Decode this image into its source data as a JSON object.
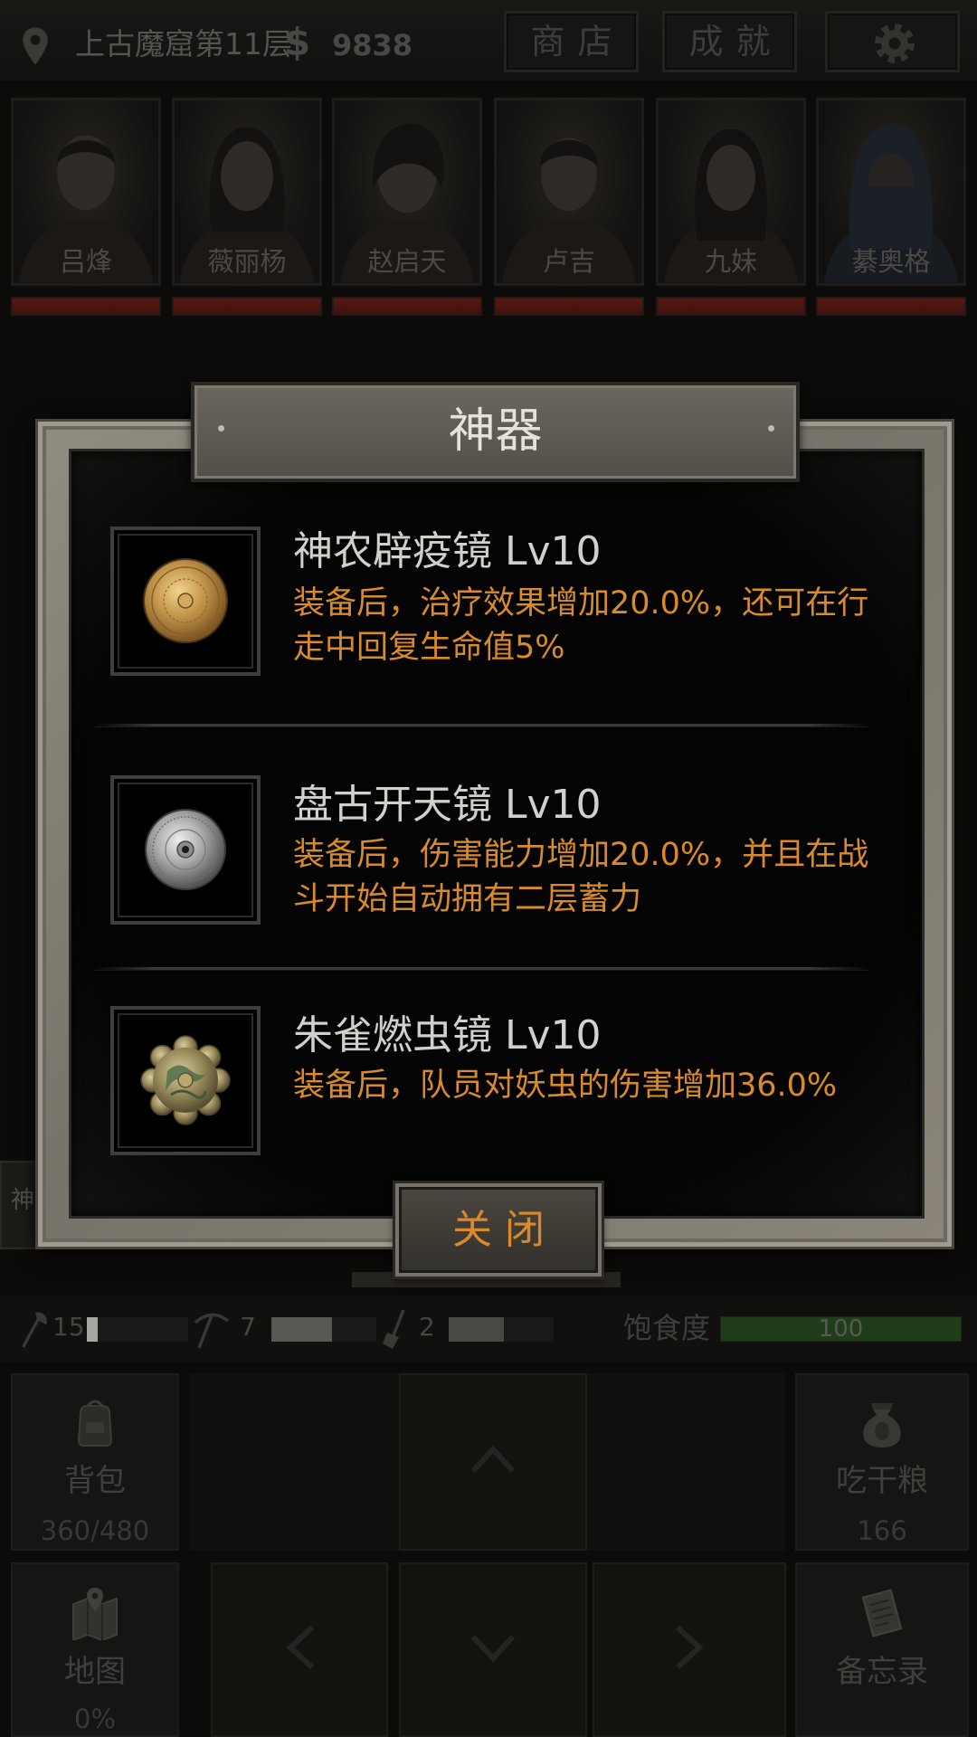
{
  "top_bar": {
    "location": "上古魔窟第11层",
    "currency_symbol": "$",
    "money": "9838",
    "shop_label": "商店",
    "achievements_label": "成就",
    "location_icon": "map-pin-icon",
    "settings_icon": "gear-icon"
  },
  "party": [
    {
      "name": "吕烽",
      "hp": 1.0
    },
    {
      "name": "薇丽杨",
      "hp": 1.0
    },
    {
      "name": "赵启天",
      "hp": 1.0
    },
    {
      "name": "卢吉",
      "hp": 1.0
    },
    {
      "name": "九妹",
      "hp": 1.0
    },
    {
      "name": "綦奥格",
      "hp": 1.0
    }
  ],
  "background_tab": {
    "label": "神"
  },
  "modal": {
    "title": "神器",
    "items": [
      {
        "name": "神农辟疫镜",
        "level": "Lv10",
        "description": [
          "装备后，治疗效果增加20.0%，还可在行",
          "走中回复生命值5%"
        ],
        "icon": "gold-bronze-mirror-icon"
      },
      {
        "name": "盘古开天镜",
        "level": "Lv10",
        "description": [
          "装备后，伤害能力增加20.0%，并且在战",
          "斗开始自动拥有二层蓄力"
        ],
        "icon": "silver-mirror-icon"
      },
      {
        "name": "朱雀燃虫镜",
        "level": "Lv10",
        "description": [
          "装备后，队员对妖虫的伤害增加36.0%"
        ],
        "icon": "jade-flower-mirror-icon"
      }
    ],
    "close_label": "关 闭"
  },
  "status_bar": {
    "tools": [
      {
        "icon": "axe-icon",
        "count": "15",
        "fill": 0.11
      },
      {
        "icon": "pickaxe-icon",
        "count": "7",
        "fill": 0.58
      },
      {
        "icon": "shovel-icon",
        "count": "2",
        "fill": 0.53
      }
    ],
    "satiety_label": "饱食度",
    "satiety_value": "100",
    "satiety_fill": 1.0
  },
  "actions": {
    "backpack": {
      "label": "背包",
      "value": "360/480",
      "icon": "backpack-icon"
    },
    "eat": {
      "label": "吃干粮",
      "value": "166",
      "icon": "ration-sack-icon"
    },
    "map": {
      "label": "地图",
      "value": "0%",
      "icon": "map-icon"
    },
    "memo": {
      "label": "备忘录",
      "icon": "memo-icon"
    },
    "arrows": [
      "up-arrow-icon",
      "left-arrow-icon",
      "down-arrow-icon",
      "right-arrow-icon"
    ]
  },
  "colors": {
    "accent_orange": "#d98a2b",
    "hp_red": "#571914",
    "satiety_green": "#1f3d19",
    "modal_frame": "#84807a"
  }
}
